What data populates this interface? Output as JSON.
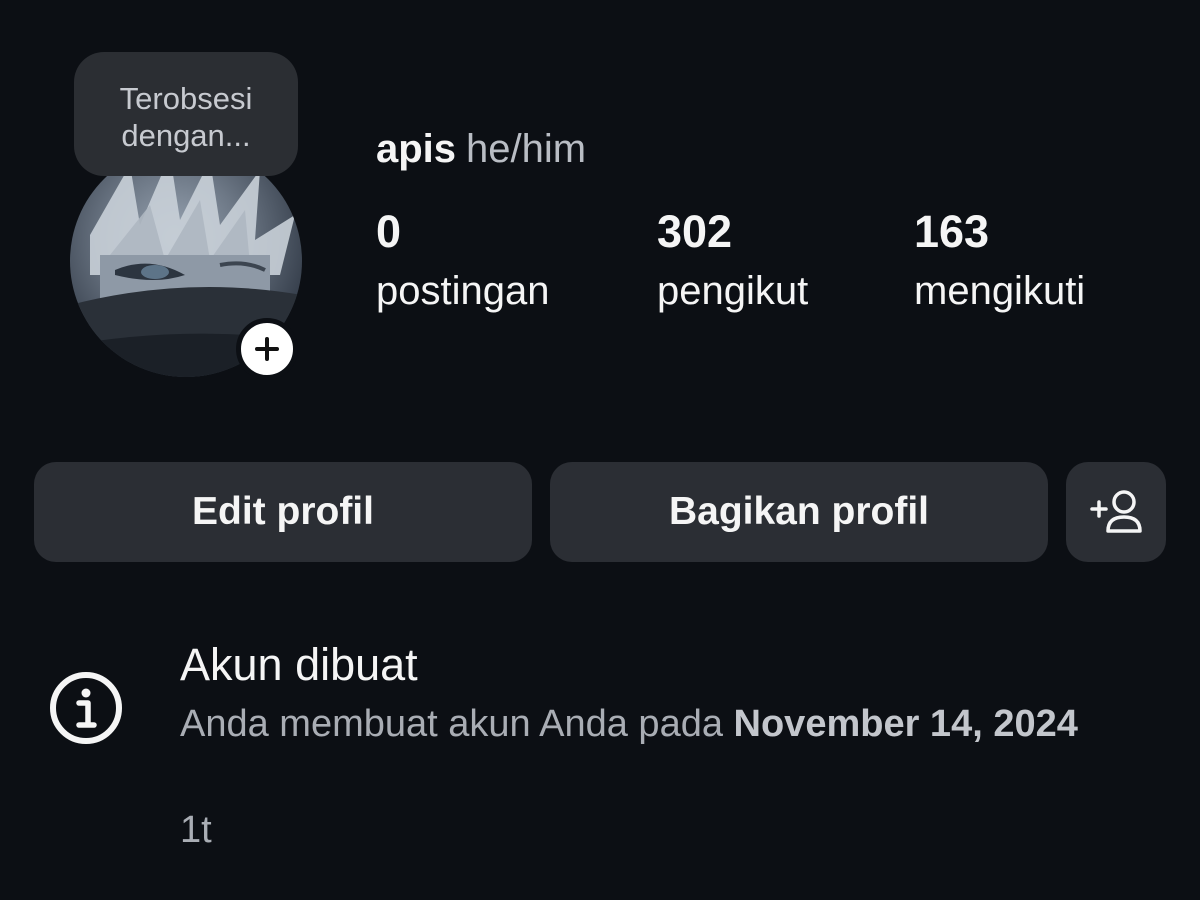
{
  "note": {
    "line1": "Terobsesi",
    "line2": "dengan..."
  },
  "profile": {
    "username": "apis",
    "pronouns": "he/him"
  },
  "stats": {
    "posts": {
      "count": "0",
      "label": "postingan"
    },
    "followers": {
      "count": "302",
      "label": "pengikut"
    },
    "following": {
      "count": "163",
      "label": "mengikuti"
    }
  },
  "buttons": {
    "edit": "Edit profil",
    "share": "Bagikan profil"
  },
  "info": {
    "title": "Akun dibuat",
    "desc_prefix": "Anda membuat akun Anda pada",
    "date": "November 14, 2024",
    "time_ago": "1t"
  },
  "icons": {
    "add_story": "plus-icon",
    "suggest": "add-person-icon",
    "info": "info-icon"
  },
  "colors": {
    "background": "#0c0f14",
    "button": "#2b2e34",
    "note_bubble": "#2b2e33"
  }
}
